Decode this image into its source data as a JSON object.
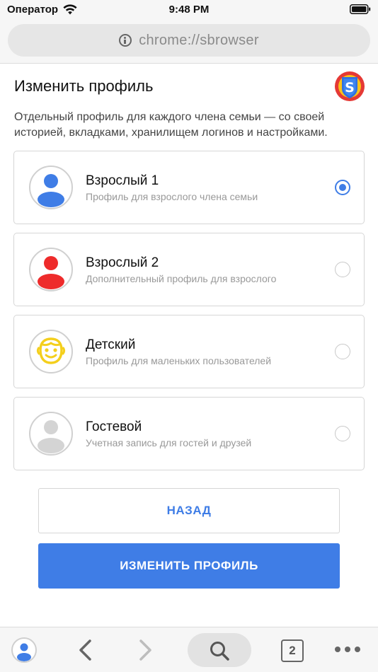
{
  "status_bar": {
    "carrier": "Оператор",
    "time": "9:48 PM"
  },
  "address_bar": {
    "url": "chrome://sbrowser"
  },
  "header": {
    "title": "Изменить профиль",
    "description": "Отдельный профиль для каждого члена семьи — со своей историей, вкладками, хранилищем логинов и настройками."
  },
  "profiles": [
    {
      "name": "Взрослый 1",
      "subtitle": "Профиль для взрослого члена семьи",
      "selected": true,
      "color": "#3f7de6"
    },
    {
      "name": "Взрослый 2",
      "subtitle": "Дополнительный профиль для взрослого",
      "selected": false,
      "color": "#ee2b2b"
    },
    {
      "name": "Детский",
      "subtitle": "Профиль для маленьких пользователей",
      "selected": false,
      "color": "#f4cf1c"
    },
    {
      "name": "Гостевой",
      "subtitle": "Учетная запись для гостей и друзей",
      "selected": false,
      "color": "#d4d4d4"
    }
  ],
  "buttons": {
    "back": "НАЗАД",
    "confirm": "ИЗМЕНИТЬ ПРОФИЛЬ"
  },
  "toolbar": {
    "tab_count": "2"
  },
  "colors": {
    "accent": "#3f7de6",
    "brand_red": "#e53935",
    "brand_yellow": "#f9c21b",
    "brand_blue": "#2f6fe0"
  }
}
